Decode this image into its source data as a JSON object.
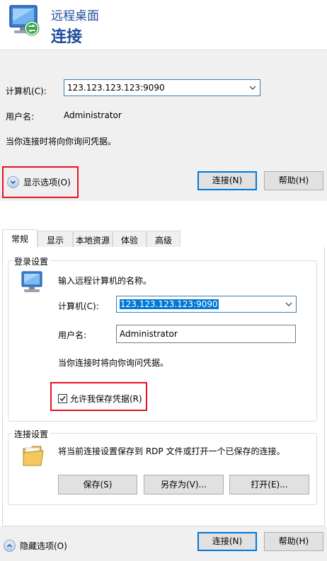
{
  "header": {
    "title_small": "远程桌面",
    "title_big": "连接"
  },
  "collapsed": {
    "computer_label": "计算机(C):",
    "computer_value": "123.123.123.123:9090",
    "username_label": "用户名:",
    "username_value": "Administrator",
    "credentials_note": "当你连接时将向你询问凭据。",
    "show_options_label": "显示选项(O)",
    "connect_label": "连接(N)",
    "help_label": "帮助(H)"
  },
  "tabs": [
    {
      "label": "常规",
      "active": true
    },
    {
      "label": "显示",
      "active": false
    },
    {
      "label": "本地资源",
      "active": false
    },
    {
      "label": "体验",
      "active": false
    },
    {
      "label": "高级",
      "active": false
    }
  ],
  "logon": {
    "group_title": "登录设置",
    "prompt": "输入远程计算机的名称。",
    "computer_label": "计算机(C):",
    "computer_value": "123.123.123.123:9090",
    "username_label": "用户名:",
    "username_value": "Administrator",
    "credentials_note": "当你连接时将向你询问凭据。",
    "allow_save_label": "允许我保存凭据(R)",
    "allow_save_checked": true
  },
  "connection": {
    "group_title": "连接设置",
    "description": "将当前连接设置保存到 RDP 文件或打开一个已保存的连接。",
    "save_label": "保存(S)",
    "save_as_label": "另存为(V)...",
    "open_label": "打开(E)..."
  },
  "footer": {
    "hide_options_label": "隐藏选项(O)",
    "connect_label": "连接(N)",
    "help_label": "帮助(H)"
  },
  "colors": {
    "accent": "#0078d7",
    "title_blue": "#1f4e9a",
    "highlight_red": "#e81123"
  }
}
